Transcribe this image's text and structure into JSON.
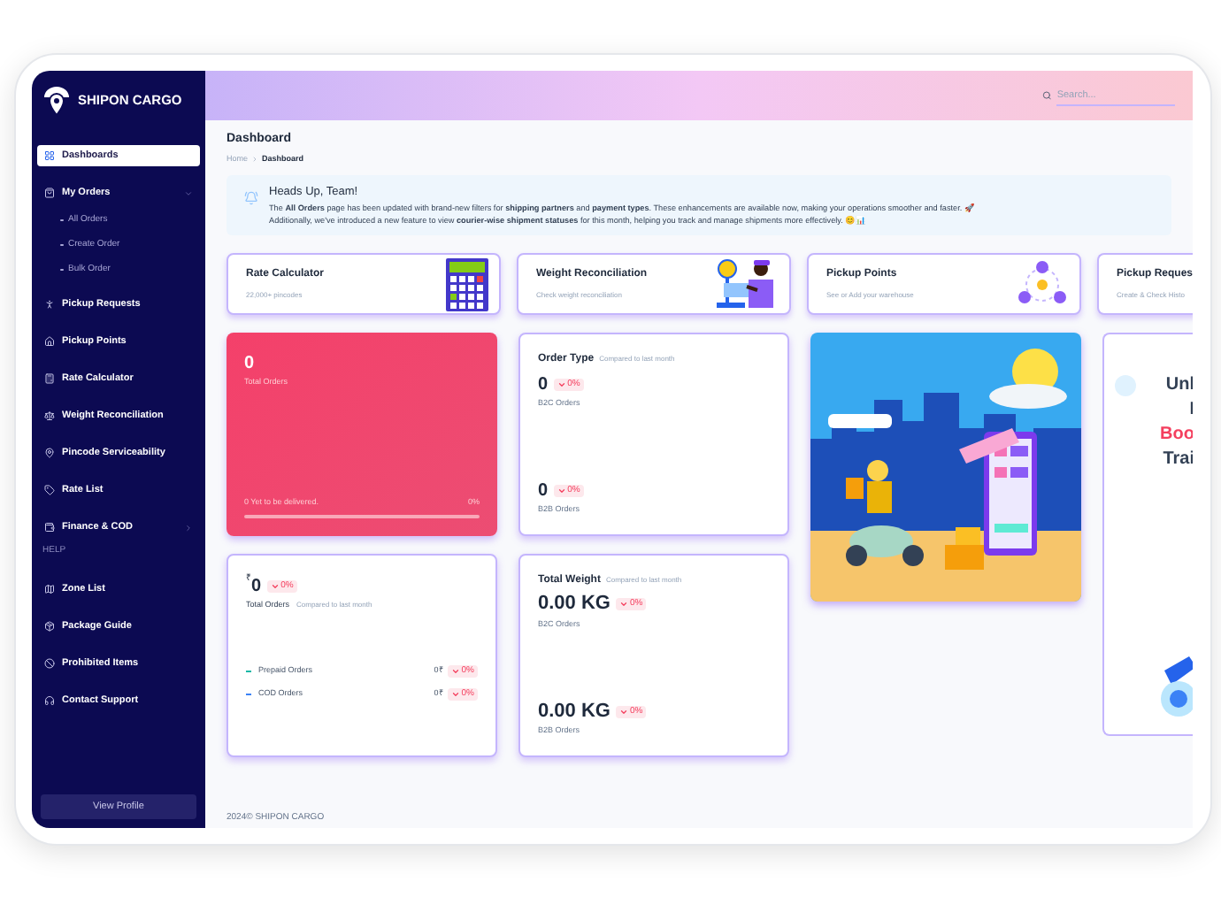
{
  "brand": {
    "name": "SHIPON CARGO"
  },
  "sidebar": {
    "items": [
      {
        "label": "Dashboards",
        "kind": "link",
        "selected": true
      },
      {
        "label": "My Orders",
        "kind": "group",
        "selected": false,
        "expanded": true,
        "children": [
          {
            "label": "All Orders",
            "selected": false
          },
          {
            "label": "Create Order",
            "selected": false
          },
          {
            "label": "Bulk Order",
            "selected": false
          }
        ]
      },
      {
        "label": "Pickup Requests",
        "kind": "link",
        "selected": false
      },
      {
        "label": "Pickup Points",
        "kind": "link",
        "selected": false
      },
      {
        "label": "Rate Calculator",
        "kind": "link",
        "selected": false
      },
      {
        "label": "Weight Reconciliation",
        "kind": "link",
        "selected": false
      },
      {
        "label": "Pincode Serviceability",
        "kind": "link",
        "selected": false
      },
      {
        "label": "Rate List",
        "kind": "link",
        "selected": false
      },
      {
        "label": "Finance & COD",
        "kind": "group",
        "selected": false,
        "expanded": false
      },
      {
        "label": "HELP",
        "kind": "heading"
      },
      {
        "label": "Zone List",
        "kind": "link",
        "selected": false
      },
      {
        "label": "Package Guide",
        "kind": "link",
        "selected": false
      },
      {
        "label": "Prohibited Items",
        "kind": "link",
        "selected": false
      },
      {
        "label": "Contact Support",
        "kind": "link",
        "selected": false
      }
    ],
    "profile_button": "View Profile"
  },
  "header": {
    "search": {
      "placeholder": "Search..."
    }
  },
  "page": {
    "title": "Dashboard",
    "breadcrumb": [
      "Home",
      "Dashboard"
    ]
  },
  "alert": {
    "title": "Heads Up, Team!",
    "lines": [
      "The **All Orders** page has been updated with brand-new filters for **shipping partners** and **payment types**. These enhancements are available now, making your operations smoother and faster. 🚀",
      "Additionally, we've introduced a new feature to view **courier-wise shipment statuses** for this month, helping you track and manage shipments more effectively. 😊📊"
    ]
  },
  "quick_cards": [
    {
      "title": "Rate Calculator",
      "subtitle": "22,000+ pincodes"
    },
    {
      "title": "Weight Reconciliation",
      "subtitle": "Check weight reconciliation"
    },
    {
      "title": "Pickup Points",
      "subtitle": "See or Add your warehouse"
    },
    {
      "title": "Pickup Reques",
      "subtitle": "Create & Check Histo"
    }
  ],
  "total_orders": {
    "value": "0",
    "label": "Total Orders",
    "progress_label": "0 Yet to be delivered.",
    "percent": "0%",
    "level": 0
  },
  "order_type": {
    "title": "Order Type",
    "compare": "Compared to last month",
    "rows": [
      {
        "value": "0",
        "change": "0%",
        "label": "B2C Orders"
      },
      {
        "value": "0",
        "change": "0%",
        "label": "B2B Orders"
      }
    ]
  },
  "revenue": {
    "currency": "₹",
    "value": "0",
    "change": "0%",
    "label": "Total Orders",
    "compare": "Compared to last month",
    "rows": [
      {
        "label": "Prepaid Orders",
        "value": "0₹",
        "change": "0%",
        "color": "#14b8a6"
      },
      {
        "label": "COD Orders",
        "value": "0₹",
        "change": "0%",
        "color": "#3b82f6"
      }
    ]
  },
  "total_weight": {
    "title": "Total Weight",
    "compare": "Compared to last month",
    "rows": [
      {
        "value": "0.00 KG",
        "change": "0%",
        "label": "B2C Orders"
      },
      {
        "value": "0.00 KG",
        "change": "0%",
        "label": "B2B Orders"
      }
    ]
  },
  "promo": {
    "lines": [
      {
        "text": "Unl",
        "highlight": false
      },
      {
        "text": "I",
        "highlight": false
      },
      {
        "text": "Boo",
        "highlight": true
      },
      {
        "text": "Trai",
        "highlight": false
      }
    ]
  },
  "footer": {
    "text": "2024© SHIPON CARGO"
  }
}
